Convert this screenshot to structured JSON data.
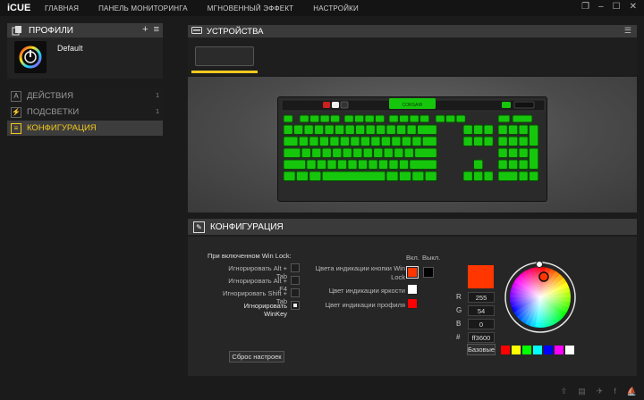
{
  "app": {
    "name": "iCUE"
  },
  "nav": [
    "ГЛАВНАЯ",
    "ПАНЕЛЬ МОНИТОРИНГА",
    "МГНОВЕННЫЙ ЭФФЕКТ",
    "НАСТРОЙКИ"
  ],
  "window_controls": {
    "restore": "❐",
    "minimize": "–",
    "maximize": "☐",
    "close": "✕"
  },
  "profiles": {
    "title": "ПРОФИЛИ",
    "add": "+",
    "menu": "≡",
    "current": "Default"
  },
  "sidebar": [
    {
      "icon": "A",
      "label": "ДЕЙСТВИЯ",
      "count": "1",
      "active": false
    },
    {
      "icon": "⚡",
      "label": "ПОДСВЕТКИ",
      "count": "1",
      "active": false
    },
    {
      "icon": "≡",
      "label": "КОНФИГУРАЦИЯ",
      "count": "",
      "active": true
    }
  ],
  "devices": {
    "title": "УСТРОЙСТВА"
  },
  "config": {
    "title": "КОНФИГУРАЦИЯ",
    "winlock_heading": "При включенном Win Lock:",
    "options": [
      {
        "label": "Игнорировать Alt + Tab",
        "checked": false
      },
      {
        "label": "Игнорировать Alt + F4",
        "checked": false
      },
      {
        "label": "Игнорировать Shift + Tab",
        "checked": false
      },
      {
        "label": "Игнорировать WinKey",
        "checked": true
      }
    ],
    "col_on": "Вкл.",
    "col_off": "Выкл.",
    "indicators": [
      {
        "label": "Цвета индикации кнопки Win Lock",
        "on_color": "#ff3600",
        "off_color": "#000000"
      },
      {
        "label": "Цвет индикации яркости",
        "on_color": "#ffffff"
      },
      {
        "label": "Цвет индикации профиля",
        "on_color": "#ff0000"
      }
    ],
    "reset_label": "Сброс настроек"
  },
  "color_picker": {
    "current": "#ff3600",
    "r_label": "R",
    "r": "255",
    "g_label": "G",
    "g": "54",
    "b_label": "B",
    "b": "0",
    "hex_label": "#",
    "hex": "ff3600",
    "basic_label": "Базовые",
    "presets": [
      "#ff0000",
      "#ffff00",
      "#00ff00",
      "#00ffff",
      "#0000ff",
      "#ff00ff",
      "#ffffff"
    ]
  },
  "keyboard": {
    "brand": "CORSAIR",
    "key_color": "#16c60c"
  }
}
